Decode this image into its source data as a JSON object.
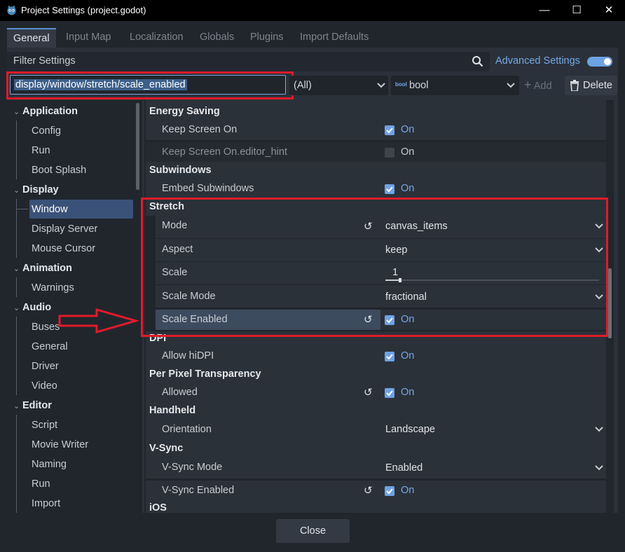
{
  "window": {
    "title": "Project Settings (project.godot)",
    "minimize": "—",
    "maximize": "☐",
    "close": "✕"
  },
  "tabs": [
    {
      "label": "General",
      "active": true
    },
    {
      "label": "Input Map"
    },
    {
      "label": "Localization"
    },
    {
      "label": "Globals"
    },
    {
      "label": "Plugins"
    },
    {
      "label": "Import Defaults"
    }
  ],
  "filter": {
    "placeholder": "Filter Settings"
  },
  "advanced": {
    "label": "Advanced Settings",
    "enabled": true
  },
  "property_input": {
    "value": "display/window/stretch/scale_enabled"
  },
  "type_filter": {
    "value": "(All)"
  },
  "type_select": {
    "icon_text": "bool",
    "value": "bool"
  },
  "toolbar": {
    "add_label": "Add",
    "delete_label": "Delete"
  },
  "tree": {
    "categories": [
      {
        "label": "Application",
        "items": [
          "Config",
          "Run",
          "Boot Splash"
        ]
      },
      {
        "label": "Display",
        "items": [
          "Window",
          "Display Server",
          "Mouse Cursor"
        ],
        "selected": "Window"
      },
      {
        "label": "Animation",
        "items": [
          "Warnings"
        ]
      },
      {
        "label": "Audio",
        "items": [
          "Buses",
          "General",
          "Driver",
          "Video"
        ]
      },
      {
        "label": "Editor",
        "items": [
          "Script",
          "Movie Writer",
          "Naming",
          "Run",
          "Import"
        ]
      }
    ]
  },
  "inspector": {
    "sections": [
      {
        "title": "Energy Saving",
        "props": [
          {
            "label": "Keep Screen On",
            "type": "bool",
            "value": "On",
            "checked": true
          },
          {
            "label": "Keep Screen On.editor_hint",
            "type": "bool",
            "value": "On",
            "checked": false,
            "dim": true
          }
        ]
      },
      {
        "title": "Subwindows",
        "props": [
          {
            "label": "Embed Subwindows",
            "type": "bool",
            "value": "On",
            "checked": true
          }
        ]
      },
      {
        "title": "Stretch",
        "props": [
          {
            "label": "Mode",
            "type": "enum",
            "value": "canvas_items",
            "revert": true
          },
          {
            "label": "Aspect",
            "type": "enum",
            "value": "keep"
          },
          {
            "label": "Scale",
            "type": "range",
            "value": "1"
          },
          {
            "label": "Scale Mode",
            "type": "enum",
            "value": "fractional"
          },
          {
            "label": "Scale Enabled",
            "type": "bool",
            "value": "On",
            "checked": true,
            "revert": true,
            "highlighted": true
          }
        ]
      },
      {
        "title": "DPI",
        "props": [
          {
            "label": "Allow hiDPI",
            "type": "bool",
            "value": "On",
            "checked": true
          }
        ]
      },
      {
        "title": "Per Pixel Transparency",
        "props": [
          {
            "label": "Allowed",
            "type": "bool",
            "value": "On",
            "checked": true,
            "revert": true
          }
        ]
      },
      {
        "title": "Handheld",
        "props": [
          {
            "label": "Orientation",
            "type": "enum",
            "value": "Landscape"
          }
        ]
      },
      {
        "title": "V-Sync",
        "props": [
          {
            "label": "V-Sync Mode",
            "type": "enum",
            "value": "Enabled"
          },
          {
            "label": "V-Sync Enabled",
            "type": "bool",
            "value": "On",
            "checked": true,
            "revert": true
          }
        ]
      },
      {
        "title": "iOS",
        "props": []
      }
    ]
  },
  "footer": {
    "close_label": "Close"
  },
  "colors": {
    "accent": "#6ea2e4",
    "annotation": "#e01b2a",
    "selection": "#3a5278"
  }
}
